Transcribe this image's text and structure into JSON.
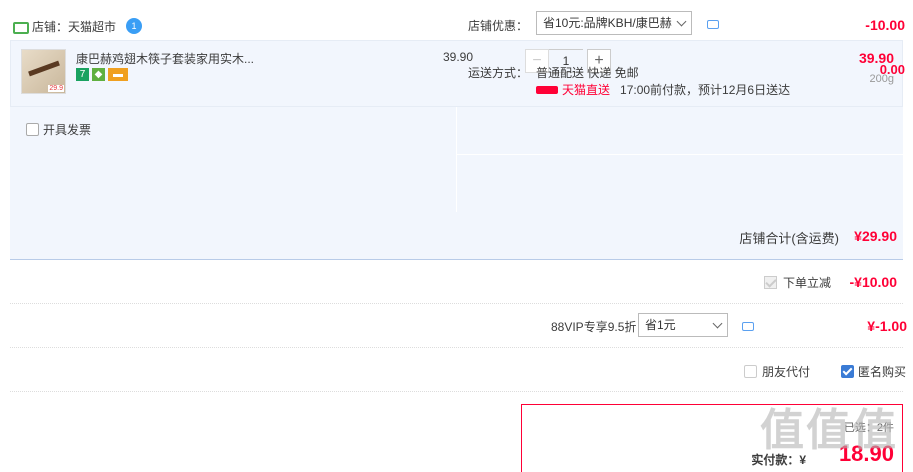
{
  "shop": {
    "label": "店铺：天猫超市",
    "wangwang_badge": "1"
  },
  "item": {
    "title": "康巴赫鸡翅木筷子套装家用实木...",
    "thumb_price": "29.9",
    "unit_price": "39.90",
    "quantity": "1",
    "minus": "−",
    "plus": "+",
    "sum": "39.90",
    "weight": "200g",
    "badge_7": "7"
  },
  "invoice": {
    "label": "开具发票"
  },
  "coupon": {
    "label": "店铺优惠：",
    "selected": "省10元:品牌KBH/康巴赫",
    "amount": "-10.00"
  },
  "shipping": {
    "label": "运送方式：",
    "method": "普通配送 快递 免邮",
    "tmall_text": "天猫直送",
    "eta": "17:00前付款，预计12月6日送达",
    "amount": "0.00"
  },
  "shop_total": {
    "label": "店铺合计(含运费)",
    "value": "¥29.90"
  },
  "instant": {
    "label": "下单立减",
    "value": "-¥10.00"
  },
  "vip": {
    "label": "88VIP专享9.5折",
    "selected": "省1元",
    "value": "¥-1.00"
  },
  "options": {
    "friend_pay": "朋友代付",
    "anonymous": "匿名购买"
  },
  "payment": {
    "count_line": "已选：2件",
    "label": "实付款：¥",
    "value": "18.90"
  },
  "watermark": "值值值",
  "colors": {
    "accent_red": "#ff0036",
    "panel_bg": "#f2f6fd",
    "link_blue": "#3a7bd5"
  }
}
